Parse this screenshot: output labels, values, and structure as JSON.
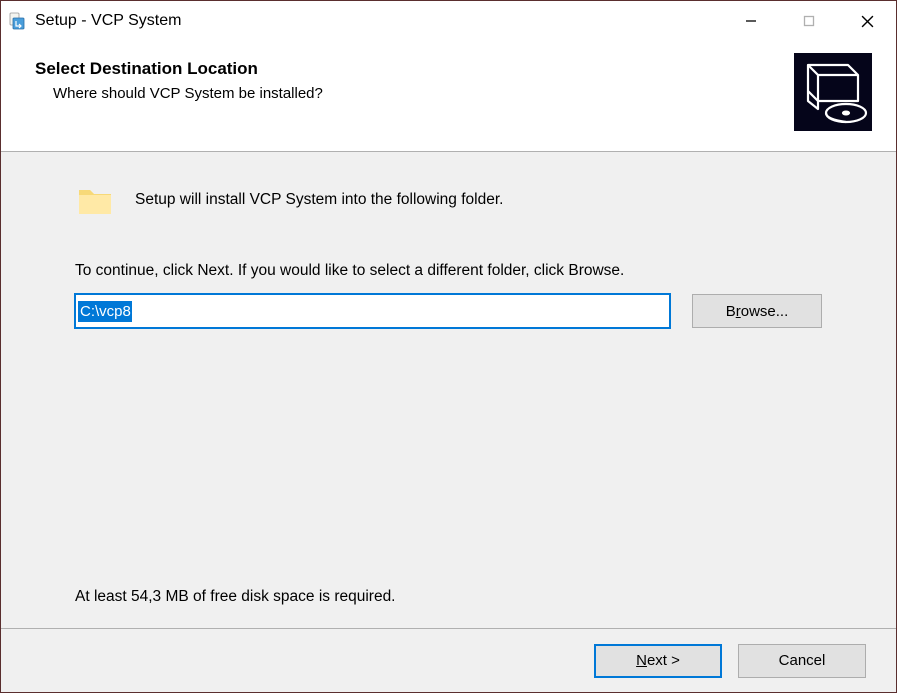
{
  "titlebar": {
    "title": "Setup - VCP System"
  },
  "header": {
    "title": "Select Destination Location",
    "subtitle": "Where should VCP System be installed?"
  },
  "content": {
    "intro": "Setup will install VCP System into the following folder.",
    "continue": "To continue, click Next. If you would like to select a different folder, click Browse.",
    "path": "C:\\vcp8",
    "browse_pre": "B",
    "browse_accel": "r",
    "browse_post": "owse...",
    "disk_required": "At least 54,3 MB of free disk space is required."
  },
  "footer": {
    "next_accel": "N",
    "next_rest": "ext >",
    "cancel": "Cancel"
  }
}
